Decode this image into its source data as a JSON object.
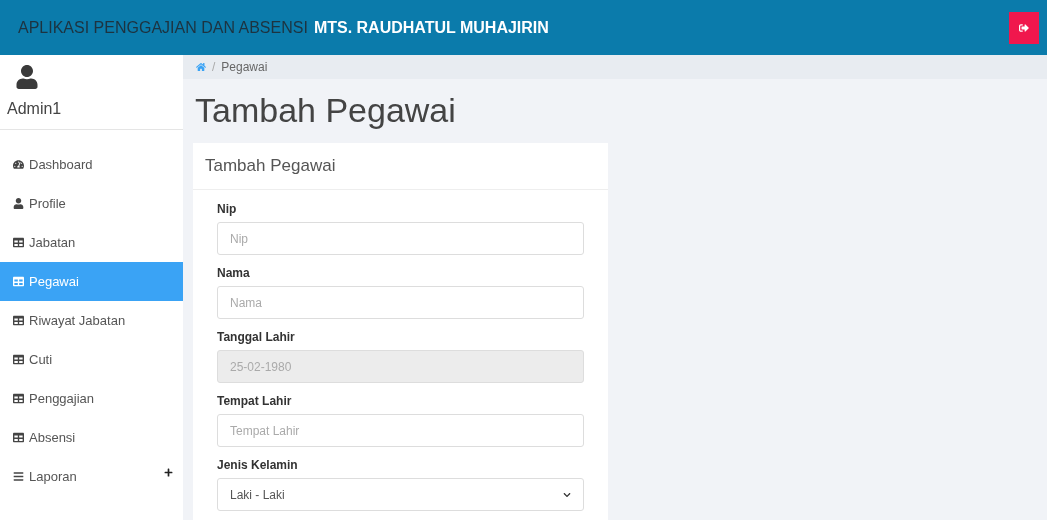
{
  "header": {
    "title_prefix": "APLIKASI PENGGAJIAN DAN ABSENSI",
    "title_highlight": "MTS. RAUDHATUL MUHAJIRIN"
  },
  "user": {
    "name": "Admin1"
  },
  "sidebar": {
    "items": [
      {
        "label": "Dashboard",
        "kind": "dashboard",
        "selected": false,
        "expandable": false
      },
      {
        "label": "Profile",
        "kind": "user",
        "selected": false,
        "expandable": false
      },
      {
        "label": "Jabatan",
        "kind": "table",
        "selected": false,
        "expandable": false
      },
      {
        "label": "Pegawai",
        "kind": "table",
        "selected": true,
        "expandable": false
      },
      {
        "label": "Riwayat Jabatan",
        "kind": "table",
        "selected": false,
        "expandable": false
      },
      {
        "label": "Cuti",
        "kind": "table",
        "selected": false,
        "expandable": false
      },
      {
        "label": "Penggajian",
        "kind": "table",
        "selected": false,
        "expandable": false
      },
      {
        "label": "Absensi",
        "kind": "table",
        "selected": false,
        "expandable": false
      },
      {
        "label": "Laporan",
        "kind": "bars",
        "selected": false,
        "expandable": true
      }
    ]
  },
  "breadcrumb": {
    "separator": "/",
    "items": [
      "Pegawai"
    ]
  },
  "page_title": "Tambah Pegawai",
  "card": {
    "title": "Tambah Pegawai",
    "fields": [
      {
        "label": "Nip",
        "kind": "input",
        "placeholder": "Nip",
        "disabled": false
      },
      {
        "label": "Nama",
        "kind": "input",
        "placeholder": "Nama",
        "disabled": false
      },
      {
        "label": "Tanggal Lahir",
        "kind": "input",
        "value": "25-02-1980",
        "disabled": true
      },
      {
        "label": "Tempat Lahir",
        "kind": "input",
        "placeholder": "Tempat Lahir",
        "disabled": false
      },
      {
        "label": "Jenis Kelamin",
        "kind": "select",
        "value": "Laki - Laki"
      }
    ]
  }
}
